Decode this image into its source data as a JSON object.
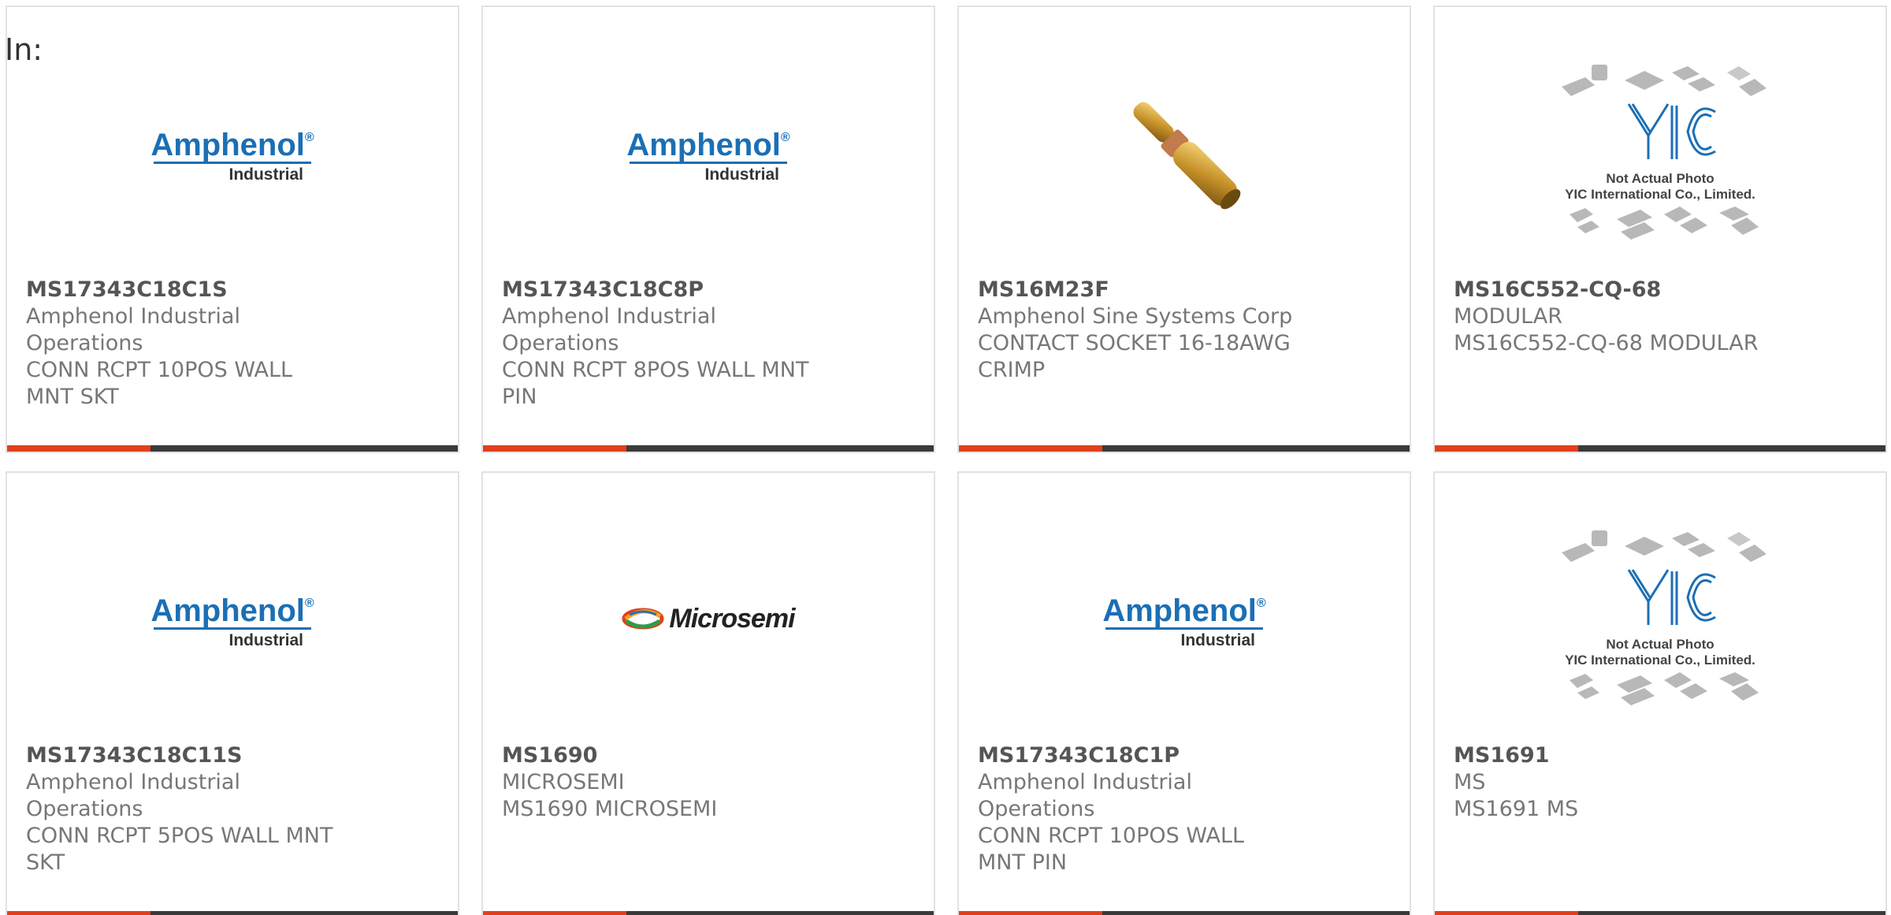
{
  "header": {
    "in_label": "In:"
  },
  "colors": {
    "accent": "#e2401c",
    "bar": "#3a3a3a",
    "amphenol_blue": "#1b6fb5"
  },
  "products": [
    {
      "part_number": "MS17343C18C1S",
      "manufacturer": "Amphenol Industrial Operations",
      "description": "CONN RCPT 10POS WALL MNT SKT",
      "image": "amphenol-logo",
      "logo_brand": "Amphenol",
      "logo_sub": "Industrial"
    },
    {
      "part_number": "MS17343C18C8P",
      "manufacturer": "Amphenol Industrial Operations",
      "description": "CONN RCPT 8POS WALL MNT PIN",
      "image": "amphenol-logo",
      "logo_brand": "Amphenol",
      "logo_sub": "Industrial"
    },
    {
      "part_number": "MS16M23F",
      "manufacturer": "Amphenol Sine Systems Corp",
      "description": "CONTACT SOCKET 16-18AWG CRIMP",
      "image": "contact-socket-photo"
    },
    {
      "part_number": "MS16C552-CQ-68",
      "manufacturer": "MODULAR",
      "description": "MS16C552-CQ-68 MODULAR",
      "image": "yic-placeholder",
      "caption_line1": "Not Actual Photo",
      "caption_line2": "YIC International Co., Limited."
    },
    {
      "part_number": "MS17343C18C11S",
      "manufacturer": "Amphenol Industrial Operations",
      "description": "CONN RCPT 5POS WALL MNT SKT",
      "image": "amphenol-logo",
      "logo_brand": "Amphenol",
      "logo_sub": "Industrial"
    },
    {
      "part_number": "MS1690",
      "manufacturer": "MICROSEMI",
      "description": "MS1690 MICROSEMI",
      "image": "microsemi-logo",
      "logo_brand": "Microsemi"
    },
    {
      "part_number": "MS17343C18C1P",
      "manufacturer": "Amphenol Industrial Operations",
      "description": "CONN RCPT 10POS WALL MNT PIN",
      "image": "amphenol-logo",
      "logo_brand": "Amphenol",
      "logo_sub": "Industrial"
    },
    {
      "part_number": "MS1691",
      "manufacturer": "MS",
      "description": "MS1691 MS",
      "image": "yic-placeholder",
      "caption_line1": "Not Actual Photo",
      "caption_line2": "YIC International Co., Limited."
    }
  ]
}
